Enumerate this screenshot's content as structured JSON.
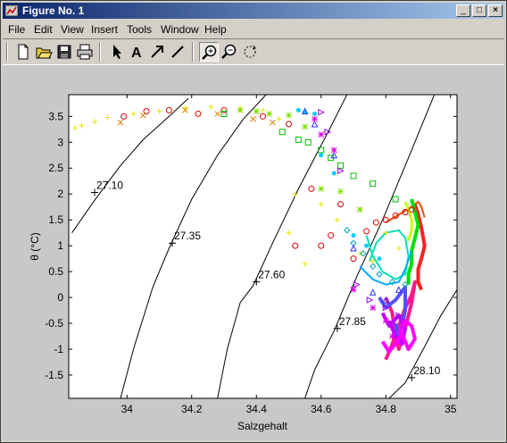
{
  "window": {
    "title": "Figure No. 1",
    "controls": {
      "minimize": "_",
      "maximize": "□",
      "close": "×"
    }
  },
  "menu": [
    "File",
    "Edit",
    "View",
    "Insert",
    "Tools",
    "Window",
    "Help"
  ],
  "toolbar": [
    {
      "name": "new-figure",
      "icon": "new-document-icon"
    },
    {
      "name": "open-file",
      "icon": "open-folder-icon"
    },
    {
      "name": "save-figure",
      "icon": "floppy-disk-icon"
    },
    {
      "name": "print-figure",
      "icon": "printer-icon"
    },
    {
      "name": "edit-plot",
      "icon": "arrow-pointer-icon"
    },
    {
      "name": "insert-text",
      "icon": "text-A-icon"
    },
    {
      "name": "insert-arrow",
      "icon": "arrow-icon"
    },
    {
      "name": "insert-line",
      "icon": "line-icon"
    },
    {
      "name": "zoom-in",
      "icon": "zoom-in-icon",
      "active": true
    },
    {
      "name": "zoom-out",
      "icon": "zoom-out-icon"
    },
    {
      "name": "rotate-3d",
      "icon": "rotate-icon"
    }
  ],
  "chart_data": {
    "type": "scatter",
    "title": "",
    "xlabel": "Salzgehalt",
    "ylabel": "θ (°C)",
    "xlim": [
      33.82,
      35.02
    ],
    "ylim": [
      -1.95,
      3.92
    ],
    "x_ticks": [
      34,
      34.2,
      34.4,
      34.6,
      34.8,
      35
    ],
    "x_tick_labels": [
      "34",
      "34.2",
      "34.4",
      "34.6",
      "34.8",
      "35"
    ],
    "y_ticks": [
      -1.5,
      -1,
      -0.5,
      0,
      0.5,
      1,
      1.5,
      2,
      2.5,
      3,
      3.5
    ],
    "y_tick_labels": [
      "-1.5",
      "-1",
      "-0.5",
      "0",
      "0.5",
      "1",
      "1.5",
      "2",
      "2.5",
      "3",
      "3.5"
    ],
    "grid": false,
    "isopycnals": [
      {
        "label": "27.10",
        "label_at": [
          33.9,
          2.03
        ],
        "points": [
          [
            33.83,
            1.25
          ],
          [
            33.9,
            1.88
          ],
          [
            33.98,
            2.55
          ],
          [
            34.05,
            3.05
          ],
          [
            34.13,
            3.5
          ],
          [
            34.19,
            3.85
          ]
        ]
      },
      {
        "label": "27.35",
        "label_at": [
          34.14,
          1.05
        ],
        "points": [
          [
            33.98,
            -1.95
          ],
          [
            34.02,
            -1.0
          ],
          [
            34.08,
            0.2
          ],
          [
            34.13,
            0.95
          ],
          [
            34.2,
            1.9
          ],
          [
            34.28,
            2.75
          ],
          [
            34.36,
            3.45
          ],
          [
            34.43,
            3.92
          ]
        ]
      },
      {
        "label": "27.60",
        "label_at": [
          34.4,
          0.3
        ],
        "points": [
          [
            34.28,
            -1.95
          ],
          [
            34.31,
            -1.0
          ],
          [
            34.35,
            -0.1
          ],
          [
            34.39,
            0.23
          ],
          [
            34.45,
            1.05
          ],
          [
            34.53,
            2.1
          ],
          [
            34.63,
            3.3
          ],
          [
            34.68,
            3.92
          ]
        ]
      },
      {
        "label": "27.85",
        "label_at": [
          34.65,
          -0.6
        ],
        "points": [
          [
            34.55,
            -1.95
          ],
          [
            34.58,
            -1.4
          ],
          [
            34.64,
            -0.65
          ],
          [
            34.71,
            0.4
          ],
          [
            34.79,
            1.5
          ],
          [
            34.87,
            2.7
          ],
          [
            34.95,
            3.92
          ]
        ]
      },
      {
        "label": "28.10",
        "label_at": [
          34.88,
          -1.55
        ],
        "points": [
          [
            34.81,
            -1.95
          ],
          [
            34.86,
            -1.65
          ],
          [
            34.92,
            -0.95
          ],
          [
            34.97,
            -0.35
          ],
          [
            35.02,
            0.15
          ]
        ]
      }
    ],
    "series": [
      {
        "marker": "plus",
        "color": "#e6e600",
        "x": [
          33.84,
          33.86,
          33.9,
          33.94,
          34.02,
          34.1,
          34.18,
          34.26,
          34.35,
          34.42,
          34.47,
          34.5,
          34.52,
          34.55,
          34.6,
          34.65,
          34.72,
          34.76,
          34.8,
          34.84
        ],
        "y": [
          3.28,
          3.32,
          3.4,
          3.48,
          3.55,
          3.6,
          3.66,
          3.68,
          3.66,
          3.62,
          3.45,
          1.25,
          2.0,
          0.65,
          1.8,
          1.5,
          0.85,
          0.7,
          1.25,
          0.95
        ]
      },
      {
        "marker": "circle",
        "color": "#e00000",
        "x": [
          33.99,
          34.06,
          34.13,
          34.22,
          34.3,
          34.42,
          34.5,
          34.52,
          34.57,
          34.6,
          34.63,
          34.66,
          34.7,
          34.74,
          34.77,
          34.8,
          34.83,
          34.86,
          34.88
        ],
        "y": [
          3.5,
          3.6,
          3.62,
          3.55,
          3.62,
          3.5,
          3.35,
          1.0,
          2.1,
          1.0,
          1.2,
          1.8,
          0.75,
          1.28,
          1.45,
          1.5,
          1.58,
          1.65,
          1.7
        ]
      },
      {
        "marker": "x",
        "color": "#e08000",
        "x": [
          33.98,
          34.05,
          34.18,
          34.28,
          34.39,
          34.45
        ],
        "y": [
          3.38,
          3.52,
          3.62,
          3.55,
          3.45,
          3.38
        ]
      },
      {
        "marker": "star",
        "color": "#80e000",
        "x": [
          34.35,
          34.4,
          34.44,
          34.5,
          34.55,
          34.6,
          34.66,
          34.72
        ],
        "y": [
          3.62,
          3.6,
          3.55,
          3.52,
          3.3,
          2.1,
          2.05,
          1.7
        ]
      },
      {
        "marker": "square",
        "color": "#00c000",
        "x": [
          34.3,
          34.48,
          34.53,
          34.56,
          34.6,
          34.63,
          34.66,
          34.7,
          34.76,
          34.83
        ],
        "y": [
          3.55,
          3.2,
          3.05,
          3.0,
          2.85,
          2.7,
          2.55,
          2.35,
          2.2,
          1.9
        ]
      },
      {
        "marker": "dot",
        "color": "#00ccff",
        "x": [
          34.53,
          34.55,
          34.58,
          34.6,
          34.64,
          34.7,
          34.74,
          34.78
        ],
        "y": [
          3.62,
          3.58,
          3.55,
          2.75,
          2.4,
          1.2,
          1.0,
          0.75
        ]
      },
      {
        "marker": "diamond",
        "color": "#00a0c0",
        "x": [
          34.68,
          34.7,
          34.73,
          34.76,
          34.78,
          34.82,
          34.86
        ],
        "y": [
          1.3,
          1.05,
          0.85,
          0.6,
          0.45,
          0.3,
          0.25
        ]
      },
      {
        "marker": "triangle",
        "color": "#3030ff",
        "x": [
          34.55,
          34.58,
          34.64,
          34.7,
          34.76,
          34.8,
          34.84
        ],
        "y": [
          3.6,
          3.35,
          2.75,
          0.95,
          0.1,
          -0.05,
          0.15
        ]
      },
      {
        "marker": "triangle-right",
        "color": "#a000e0",
        "x": [
          34.6,
          34.62,
          34.66,
          34.71,
          34.75,
          34.8,
          34.84
        ],
        "y": [
          3.58,
          3.2,
          2.45,
          0.25,
          -0.05,
          -0.2,
          -0.35
        ]
      },
      {
        "marker": "star",
        "color": "#e000e0",
        "x": [
          34.58,
          34.6,
          34.64,
          34.7,
          34.76,
          34.8,
          34.82
        ],
        "y": [
          3.45,
          3.15,
          2.85,
          0.15,
          -0.2,
          -0.45,
          -0.75
        ]
      }
    ],
    "traces": [
      {
        "color": "#ff1a8c",
        "width": 4,
        "x": [
          34.8,
          34.82,
          34.84,
          34.86,
          34.88,
          34.89,
          34.88,
          34.86,
          34.84,
          34.83,
          34.82,
          34.8
        ],
        "y": [
          -1.2,
          -0.9,
          -0.55,
          -0.2,
          0.05,
          0.3,
          -0.1,
          -0.6,
          -1.0,
          -0.75,
          -0.3,
          0.0
        ]
      },
      {
        "color": "#e05000",
        "width": 2,
        "x": [
          34.8,
          34.84,
          34.88,
          34.9,
          34.91,
          34.92
        ],
        "y": [
          1.45,
          1.6,
          1.75,
          1.85,
          1.75,
          1.55
        ]
      },
      {
        "color": "#ff2020",
        "width": 4,
        "x": [
          34.89,
          34.9,
          34.91,
          34.92,
          34.91,
          34.9,
          34.9,
          34.91
        ],
        "y": [
          1.8,
          1.6,
          1.35,
          1.0,
          0.75,
          0.55,
          0.3,
          0.15
        ]
      },
      {
        "color": "#00dd00",
        "width": 4,
        "x": [
          34.88,
          34.89,
          34.9,
          34.89,
          34.88,
          34.88,
          34.87,
          34.87
        ],
        "y": [
          1.9,
          1.65,
          1.4,
          1.15,
          0.9,
          0.65,
          0.45,
          0.25
        ]
      },
      {
        "color": "#c8ff00",
        "width": 3,
        "x": [
          34.86,
          34.87,
          34.88,
          34.88,
          34.87
        ],
        "y": [
          1.85,
          1.7,
          1.5,
          1.3,
          1.1
        ]
      },
      {
        "color": "#00e0b0",
        "width": 2,
        "x": [
          34.74,
          34.76,
          34.79,
          34.83,
          34.86,
          34.87,
          34.86,
          34.84,
          34.8,
          34.77,
          34.75
        ],
        "y": [
          1.2,
          0.8,
          0.5,
          0.35,
          0.45,
          0.8,
          1.15,
          1.3,
          1.25,
          1.05,
          0.7
        ]
      },
      {
        "color": "#00aaff",
        "width": 2,
        "x": [
          34.72,
          34.76,
          34.8,
          34.84,
          34.86,
          34.88
        ],
        "y": [
          0.6,
          0.35,
          0.25,
          0.3,
          0.55,
          0.9
        ]
      },
      {
        "color": "#5050ff",
        "width": 4,
        "x": [
          34.78,
          34.8,
          34.83,
          34.86,
          34.86,
          34.85,
          34.84,
          34.83
        ],
        "y": [
          0.0,
          -0.2,
          -0.05,
          0.2,
          -0.25,
          -0.55,
          -0.75,
          -0.5
        ]
      },
      {
        "color": "#c000ff",
        "width": 4,
        "x": [
          34.79,
          34.81,
          34.84,
          34.86,
          34.85,
          34.83,
          34.81
        ],
        "y": [
          -0.3,
          -0.55,
          -0.35,
          -0.6,
          -0.9,
          -0.75,
          -0.45
        ]
      },
      {
        "color": "#ff00ff",
        "width": 4,
        "x": [
          34.79,
          34.81,
          34.83,
          34.85,
          34.87,
          34.89,
          34.88,
          34.86,
          34.84
        ],
        "y": [
          -0.85,
          -1.05,
          -0.9,
          -0.7,
          -1.0,
          -0.8,
          -0.55,
          -0.45,
          -0.7
        ]
      }
    ]
  }
}
